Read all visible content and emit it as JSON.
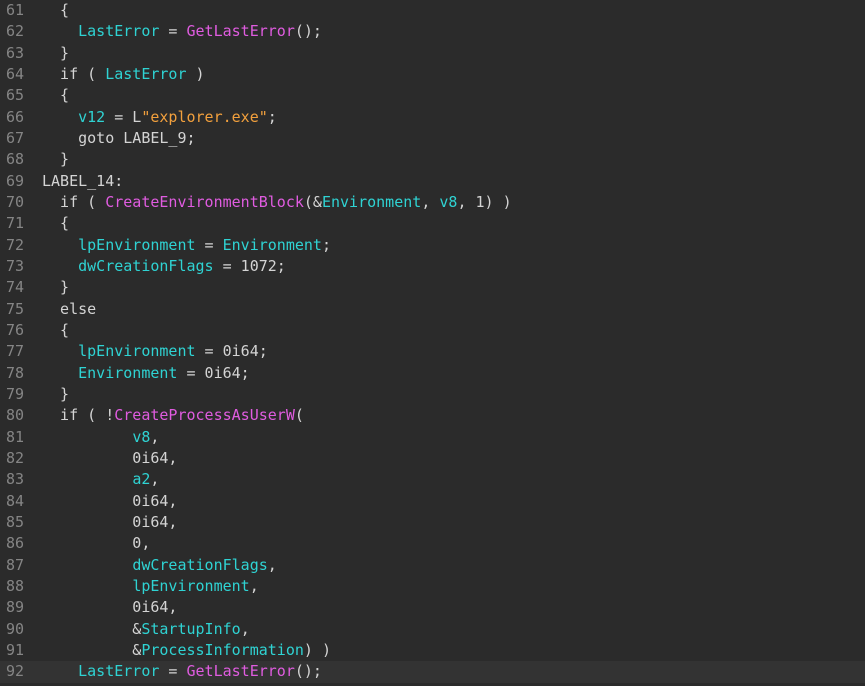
{
  "editor": {
    "colors": {
      "background": "#2b2b2b",
      "current_line": "#333333",
      "gutter_text": "#858585",
      "plain": "#d4d4d4",
      "variable": "#2fd3d3",
      "function": "#e05ce0",
      "string": "#f2a03d"
    },
    "current_line_number": "92",
    "lines": [
      {
        "num": "61",
        "tokens": [
          {
            "t": "  {",
            "c": "plain"
          }
        ]
      },
      {
        "num": "62",
        "tokens": [
          {
            "t": "    ",
            "c": "plain"
          },
          {
            "t": "LastError",
            "c": "var"
          },
          {
            "t": " = ",
            "c": "plain"
          },
          {
            "t": "GetLastError",
            "c": "func"
          },
          {
            "t": "();",
            "c": "plain"
          }
        ]
      },
      {
        "num": "63",
        "tokens": [
          {
            "t": "  }",
            "c": "plain"
          }
        ]
      },
      {
        "num": "64",
        "tokens": [
          {
            "t": "  if ( ",
            "c": "plain"
          },
          {
            "t": "LastError",
            "c": "var"
          },
          {
            "t": " )",
            "c": "plain"
          }
        ]
      },
      {
        "num": "65",
        "tokens": [
          {
            "t": "  {",
            "c": "plain"
          }
        ]
      },
      {
        "num": "66",
        "tokens": [
          {
            "t": "    ",
            "c": "plain"
          },
          {
            "t": "v12",
            "c": "var"
          },
          {
            "t": " = L",
            "c": "plain"
          },
          {
            "t": "\"explorer.exe\"",
            "c": "str"
          },
          {
            "t": ";",
            "c": "plain"
          }
        ]
      },
      {
        "num": "67",
        "tokens": [
          {
            "t": "    goto LABEL_9;",
            "c": "plain"
          }
        ]
      },
      {
        "num": "68",
        "tokens": [
          {
            "t": "  }",
            "c": "plain"
          }
        ]
      },
      {
        "num": "69",
        "tokens": [
          {
            "t": "LABEL_14:",
            "c": "plain"
          }
        ]
      },
      {
        "num": "70",
        "tokens": [
          {
            "t": "  if ( ",
            "c": "plain"
          },
          {
            "t": "CreateEnvironmentBlock",
            "c": "func"
          },
          {
            "t": "(&",
            "c": "plain"
          },
          {
            "t": "Environment",
            "c": "var"
          },
          {
            "t": ", ",
            "c": "plain"
          },
          {
            "t": "v8",
            "c": "var"
          },
          {
            "t": ", 1) )",
            "c": "plain"
          }
        ]
      },
      {
        "num": "71",
        "tokens": [
          {
            "t": "  {",
            "c": "plain"
          }
        ]
      },
      {
        "num": "72",
        "tokens": [
          {
            "t": "    ",
            "c": "plain"
          },
          {
            "t": "lpEnvironment",
            "c": "var"
          },
          {
            "t": " = ",
            "c": "plain"
          },
          {
            "t": "Environment",
            "c": "var"
          },
          {
            "t": ";",
            "c": "plain"
          }
        ]
      },
      {
        "num": "73",
        "tokens": [
          {
            "t": "    ",
            "c": "plain"
          },
          {
            "t": "dwCreationFlags",
            "c": "var"
          },
          {
            "t": " = 1072;",
            "c": "plain"
          }
        ]
      },
      {
        "num": "74",
        "tokens": [
          {
            "t": "  }",
            "c": "plain"
          }
        ]
      },
      {
        "num": "75",
        "tokens": [
          {
            "t": "  else",
            "c": "plain"
          }
        ]
      },
      {
        "num": "76",
        "tokens": [
          {
            "t": "  {",
            "c": "plain"
          }
        ]
      },
      {
        "num": "77",
        "tokens": [
          {
            "t": "    ",
            "c": "plain"
          },
          {
            "t": "lpEnvironment",
            "c": "var"
          },
          {
            "t": " = 0i64;",
            "c": "plain"
          }
        ]
      },
      {
        "num": "78",
        "tokens": [
          {
            "t": "    ",
            "c": "plain"
          },
          {
            "t": "Environment",
            "c": "var"
          },
          {
            "t": " = 0i64;",
            "c": "plain"
          }
        ]
      },
      {
        "num": "79",
        "tokens": [
          {
            "t": "  }",
            "c": "plain"
          }
        ]
      },
      {
        "num": "80",
        "tokens": [
          {
            "t": "  if ( !",
            "c": "plain"
          },
          {
            "t": "CreateProcessAsUserW",
            "c": "func"
          },
          {
            "t": "(",
            "c": "plain"
          }
        ]
      },
      {
        "num": "81",
        "tokens": [
          {
            "t": "          ",
            "c": "plain"
          },
          {
            "t": "v8",
            "c": "var"
          },
          {
            "t": ",",
            "c": "plain"
          }
        ]
      },
      {
        "num": "82",
        "tokens": [
          {
            "t": "          0i64,",
            "c": "plain"
          }
        ]
      },
      {
        "num": "83",
        "tokens": [
          {
            "t": "          ",
            "c": "plain"
          },
          {
            "t": "a2",
            "c": "var"
          },
          {
            "t": ",",
            "c": "plain"
          }
        ]
      },
      {
        "num": "84",
        "tokens": [
          {
            "t": "          0i64,",
            "c": "plain"
          }
        ]
      },
      {
        "num": "85",
        "tokens": [
          {
            "t": "          0i64,",
            "c": "plain"
          }
        ]
      },
      {
        "num": "86",
        "tokens": [
          {
            "t": "          0,",
            "c": "plain"
          }
        ]
      },
      {
        "num": "87",
        "tokens": [
          {
            "t": "          ",
            "c": "plain"
          },
          {
            "t": "dwCreationFlags",
            "c": "var"
          },
          {
            "t": ",",
            "c": "plain"
          }
        ]
      },
      {
        "num": "88",
        "tokens": [
          {
            "t": "          ",
            "c": "plain"
          },
          {
            "t": "lpEnvironment",
            "c": "var"
          },
          {
            "t": ",",
            "c": "plain"
          }
        ]
      },
      {
        "num": "89",
        "tokens": [
          {
            "t": "          0i64,",
            "c": "plain"
          }
        ]
      },
      {
        "num": "90",
        "tokens": [
          {
            "t": "          &",
            "c": "plain"
          },
          {
            "t": "StartupInfo",
            "c": "var"
          },
          {
            "t": ",",
            "c": "plain"
          }
        ]
      },
      {
        "num": "91",
        "tokens": [
          {
            "t": "          &",
            "c": "plain"
          },
          {
            "t": "ProcessInformation",
            "c": "var"
          },
          {
            "t": ") )",
            "c": "plain"
          }
        ]
      },
      {
        "num": "92",
        "tokens": [
          {
            "t": "    ",
            "c": "plain"
          },
          {
            "t": "LastError",
            "c": "var"
          },
          {
            "t": " = ",
            "c": "plain"
          },
          {
            "t": "GetLastError",
            "c": "func"
          },
          {
            "t": "();",
            "c": "plain"
          }
        ]
      }
    ]
  }
}
